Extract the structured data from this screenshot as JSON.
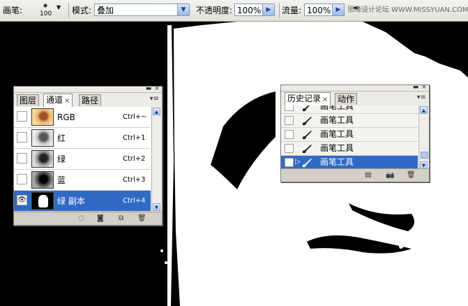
{
  "options_bar": {
    "brush_label": "画笔:",
    "brush_size": "100",
    "mode_label": "模式:",
    "mode_value": "叠加",
    "opacity_label": "不透明度:",
    "opacity_value": "100%",
    "flow_label": "流量:",
    "flow_value": "100%",
    "watermark": "思缘设计论坛 WWW.MISSYUAN.COM"
  },
  "channels_panel": {
    "tabs": [
      {
        "label": "图层",
        "active": false
      },
      {
        "label": "通道",
        "active": true,
        "close": "×"
      },
      {
        "label": "路径",
        "active": false
      }
    ],
    "menu_icon": "▾≡",
    "channels": [
      {
        "name": "RGB",
        "shortcut": "Ctrl+~",
        "visible": false,
        "selected": false
      },
      {
        "name": "红",
        "shortcut": "Ctrl+1",
        "visible": false,
        "selected": false
      },
      {
        "name": "绿",
        "shortcut": "Ctrl+2",
        "visible": false,
        "selected": false
      },
      {
        "name": "蓝",
        "shortcut": "Ctrl+3",
        "visible": false,
        "selected": false
      },
      {
        "name": "绿 副本",
        "shortcut": "Ctrl+4",
        "visible": true,
        "selected": true
      }
    ]
  },
  "history_panel": {
    "tabs": [
      {
        "label": "历史记录",
        "active": true,
        "close": "×"
      },
      {
        "label": "动作",
        "active": false
      }
    ],
    "menu_icon": "▾≡",
    "states": [
      {
        "name": "画笔工具",
        "selected": false
      },
      {
        "name": "画笔工具",
        "selected": false
      },
      {
        "name": "画笔工具",
        "selected": false
      },
      {
        "name": "画笔工具",
        "selected": false
      },
      {
        "name": "画笔工具",
        "selected": true
      }
    ]
  },
  "colors": {
    "selection": "#316ac5",
    "panel_bg": "#d4d0c8",
    "canvas_black": "#000000",
    "canvas_white": "#ffffff"
  }
}
